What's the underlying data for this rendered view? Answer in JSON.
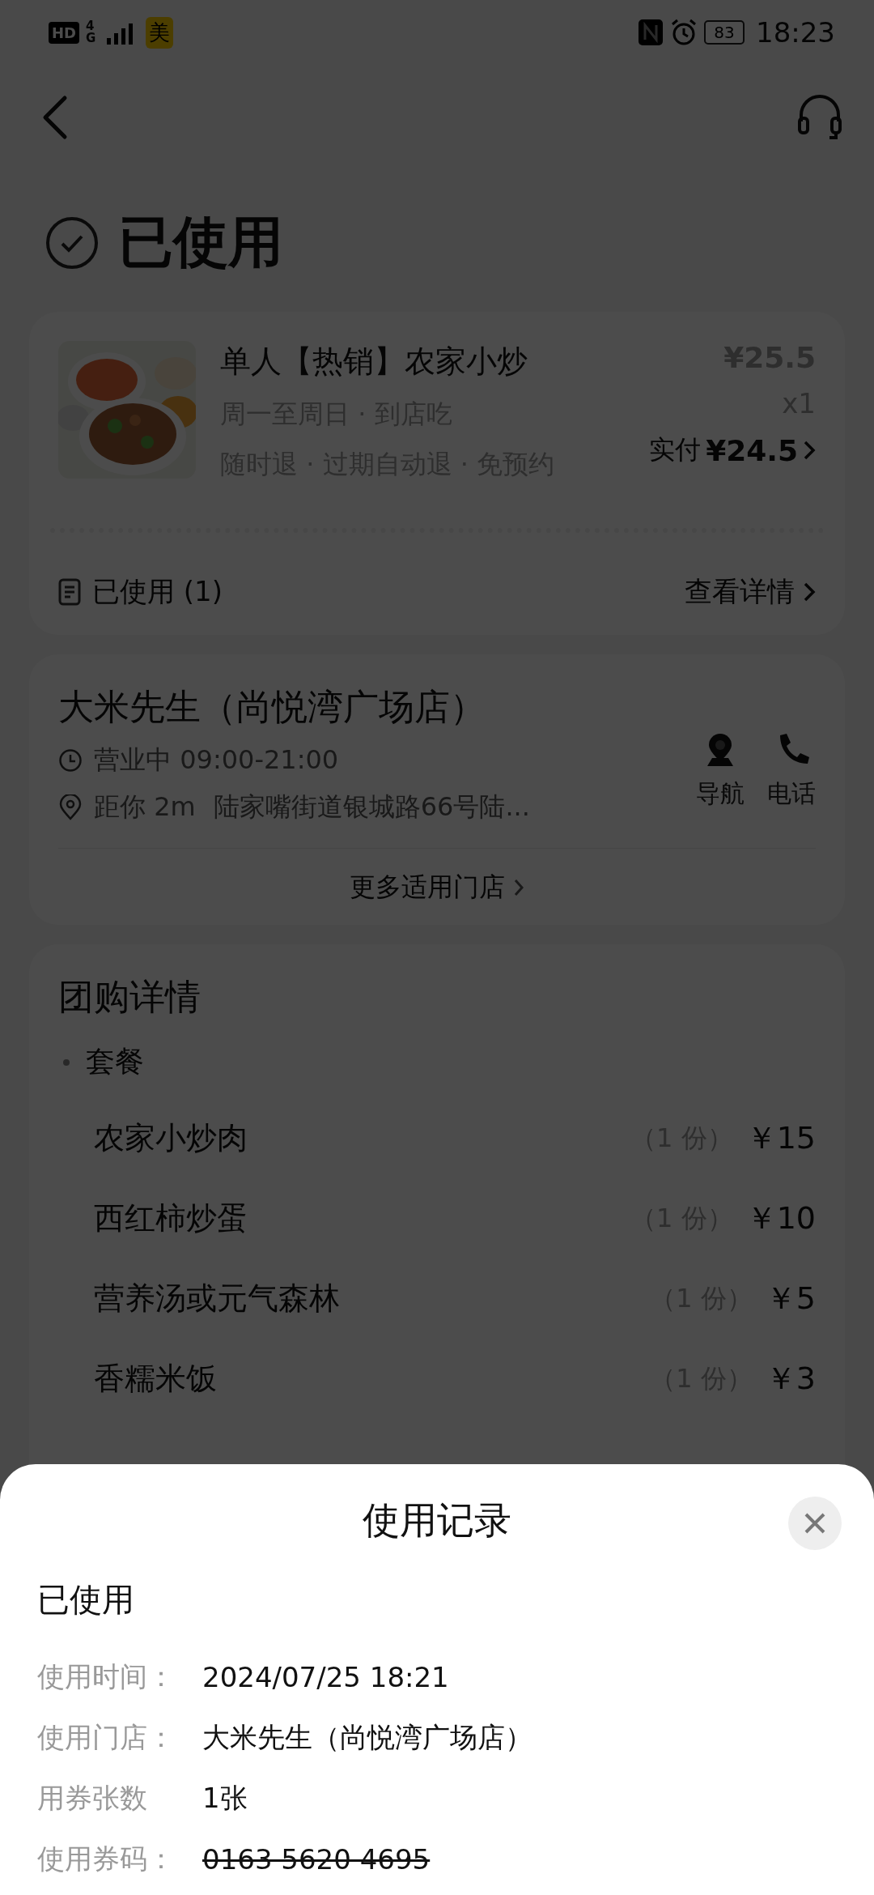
{
  "status_bar": {
    "hd": "HD",
    "network": "4G",
    "app_badge": "美",
    "battery": "83",
    "time": "18:23"
  },
  "header": {
    "status": "已使用"
  },
  "order": {
    "name": "单人【热销】农家小炒",
    "tags": "周一至周日 · 到店吃",
    "rules": "随时退 · 过期自动退 · 免预约",
    "price": "¥25.5",
    "quantity": "x1",
    "paid_label": "实付",
    "paid_amount": "¥24.5",
    "used_label": "已使用 (1)",
    "details_link": "查看详情"
  },
  "store": {
    "name": "大米先生（尚悦湾广场店）",
    "hours": "营业中 09:00-21:00",
    "distance": "距你 2m",
    "address": "陆家嘴街道银城路66号陆...",
    "actions": [
      {
        "kind": "navigate",
        "label": "导航"
      },
      {
        "kind": "phone",
        "label": "电话"
      }
    ],
    "more_link": "更多适用门店"
  },
  "deal": {
    "title": "团购详情",
    "section": "套餐",
    "items": [
      {
        "name": "农家小炒肉",
        "qty": "（1 份）",
        "price": "￥15"
      },
      {
        "name": "西红柿炒蛋",
        "qty": "（1 份）",
        "price": "￥10"
      },
      {
        "name": "营养汤或元气森林",
        "qty": "（1 份）",
        "price": "￥5"
      },
      {
        "name": "香糯米饭",
        "qty": "（1 份）",
        "price": "￥3"
      }
    ]
  },
  "sheet": {
    "title": "使用记录",
    "status": "已使用",
    "rows": [
      {
        "label": "使用时间：",
        "value": "2024/07/25 18:21",
        "struck": false
      },
      {
        "label": "使用门店：",
        "value": "大米先生（尚悦湾广场店）",
        "struck": false
      },
      {
        "label": "用券张数",
        "value": "1张",
        "struck": false
      },
      {
        "label": "使用券码：",
        "value": "0163 5620 4695",
        "struck": true
      }
    ]
  }
}
